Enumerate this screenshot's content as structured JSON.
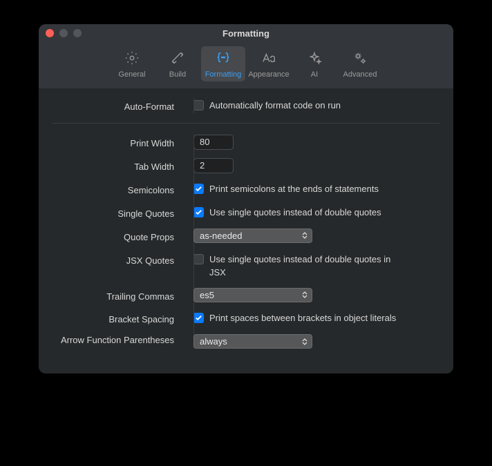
{
  "window": {
    "title": "Formatting"
  },
  "tabs": {
    "general": "General",
    "build": "Build",
    "formatting": "Formatting",
    "appearance": "Appearance",
    "ai": "AI",
    "advanced": "Advanced"
  },
  "sections": {
    "autoFormat": {
      "label": "Auto-Format",
      "checked": false,
      "desc": "Automatically format code on run"
    },
    "printWidth": {
      "label": "Print Width",
      "value": "80"
    },
    "tabWidth": {
      "label": "Tab Width",
      "value": "2"
    },
    "semicolons": {
      "label": "Semicolons",
      "checked": true,
      "desc": "Print semicolons at the ends of statements"
    },
    "singleQuotes": {
      "label": "Single Quotes",
      "checked": true,
      "desc": "Use single quotes instead of double quotes"
    },
    "quoteProps": {
      "label": "Quote Props",
      "value": "as-needed"
    },
    "jsxQuotes": {
      "label": "JSX Quotes",
      "checked": false,
      "desc": "Use single quotes instead of double quotes in JSX"
    },
    "trailingCommas": {
      "label": "Trailing Commas",
      "value": "es5"
    },
    "bracketSpacing": {
      "label": "Bracket Spacing",
      "checked": true,
      "desc": "Print spaces between brackets in object literals"
    },
    "arrowParens": {
      "label": "Arrow Function Parentheses",
      "value": "always"
    }
  }
}
